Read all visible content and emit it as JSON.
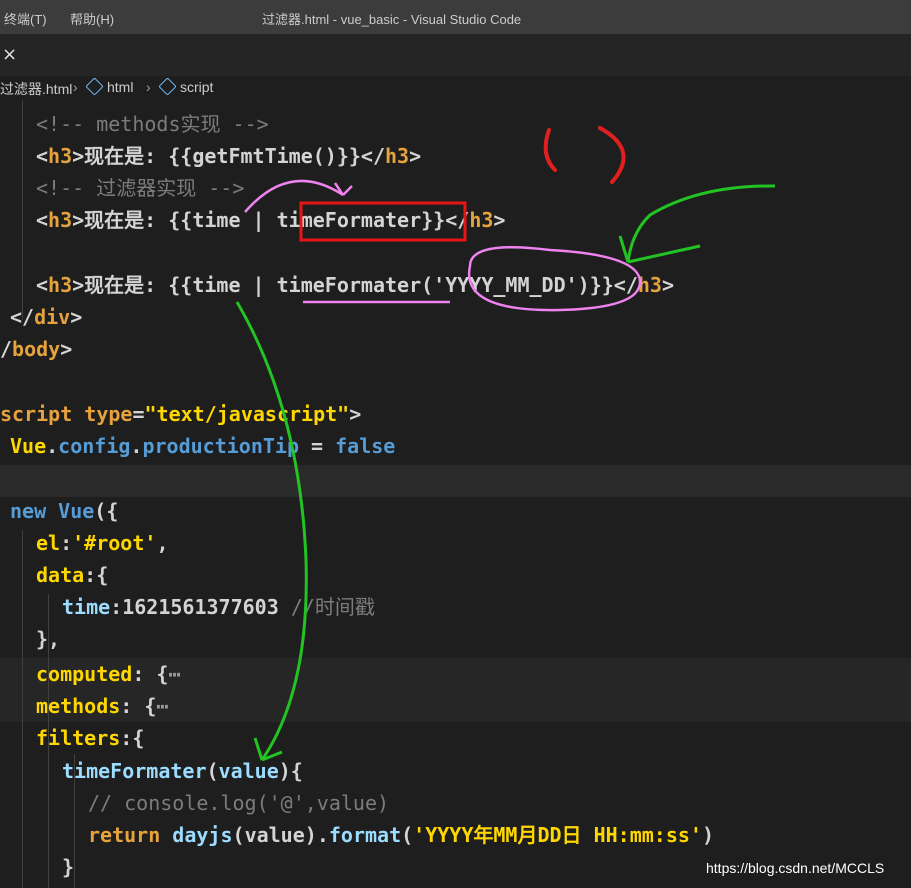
{
  "menu": {
    "terminal": "终端(T)",
    "help": "帮助(H)"
  },
  "window_title": "过滤器.html - vue_basic - Visual Studio Code",
  "tab": {
    "close": "×"
  },
  "breadcrumb": {
    "file": "过滤器.html",
    "html": "html",
    "script": "script"
  },
  "code": {
    "l1": [
      "<!-- methods实现 -->"
    ],
    "l2": [
      "<",
      "h3",
      ">现在是: {{getFmtTime()}}</",
      "h3",
      ">"
    ],
    "l3": [
      "<!-- 过滤器实现 -->"
    ],
    "l4": [
      "<",
      "h3",
      ">现在是: {{time | ",
      "timeFormater",
      "}}</",
      "h3",
      ">"
    ],
    "l5": [
      "<",
      "h3",
      ">现在是: {{time | timeFormater(",
      "'YYYY_MM_DD'",
      ")}}</",
      "h3",
      ">"
    ],
    "l6": [
      "</",
      "div",
      ">"
    ],
    "l7": [
      "/",
      "body",
      ">"
    ],
    "l8": [
      "script ",
      "type",
      "=",
      "\"text/javascript\"",
      ">"
    ],
    "l9": [
      "Vue",
      ".",
      "config",
      ".",
      "productionTip",
      " = ",
      "false"
    ],
    "l10": [
      "new ",
      "Vue",
      "({"
    ],
    "l11": [
      "el",
      ":",
      "'#root'",
      ","
    ],
    "l12": [
      "data",
      ":{"
    ],
    "l13": [
      "time",
      ":",
      "1621561377603",
      " ",
      "//时间戳"
    ],
    "l14": [
      "},"
    ],
    "l15": [
      "computed",
      ": {",
      "⋯"
    ],
    "l16": [
      "methods",
      ": {",
      "⋯"
    ],
    "l17": [
      "filters",
      ":{"
    ],
    "l18": [
      "timeFormater",
      "(",
      "value",
      "){"
    ],
    "l19": [
      "// console.log('@',value)"
    ],
    "l20": [
      "return ",
      "dayjs",
      "(",
      "value",
      ").",
      "format",
      "(",
      "'YYYY年MM月DD日 HH:mm:ss'",
      ")"
    ],
    "l21": [
      "}"
    ]
  },
  "watermark": "https://blog.csdn.net/MCCLS"
}
